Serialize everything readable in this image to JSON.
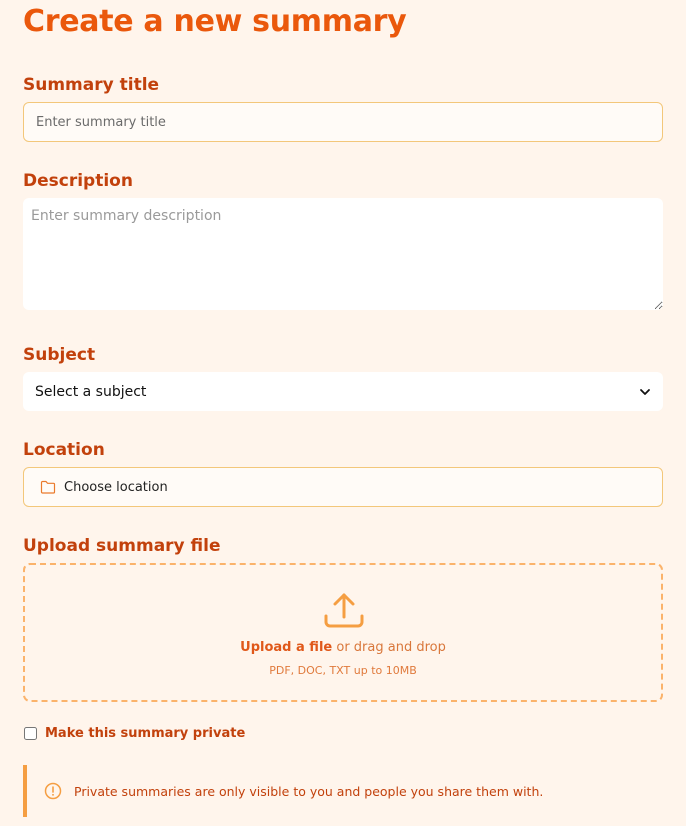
{
  "header": {
    "title": "Create a new summary"
  },
  "fields": {
    "title_label": "Summary title",
    "title_placeholder": "Enter summary title",
    "description_label": "Description",
    "description_placeholder": "Enter summary description",
    "subject_label": "Subject",
    "subject_value": "Select a subject",
    "location_label": "Location",
    "location_value": "Choose location",
    "upload_label": "Upload summary file"
  },
  "upload": {
    "link_text": "Upload a file",
    "drag_text": "or drag and drop",
    "hint": "PDF, DOC, TXT up to 10MB"
  },
  "privacy": {
    "checkbox_label": "Make this summary private",
    "checked": false,
    "notice": "Private summaries are only visible to you and people you share them with."
  },
  "colors": {
    "accent": "#ea580c",
    "label": "#c2410c",
    "background": "#fff5ec",
    "border": "#f3c77a"
  }
}
